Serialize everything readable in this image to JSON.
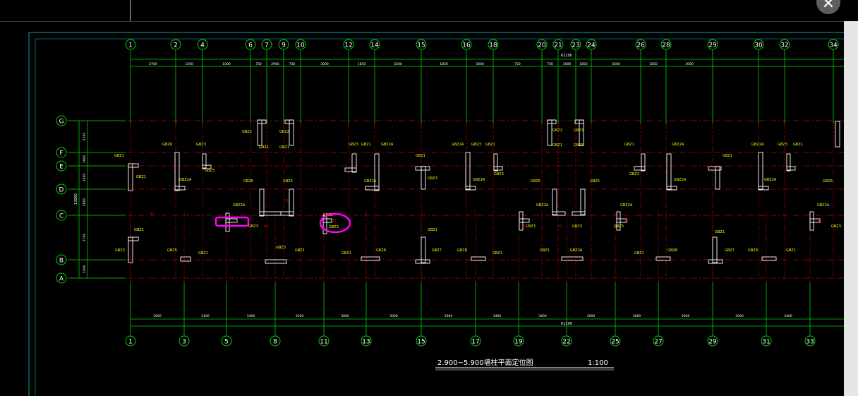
{
  "window": {
    "close_symbol": "✕",
    "close_icon": "close-icon"
  },
  "drawing": {
    "title": "2.900~5.900墙柱平面定位图",
    "scale": "1:100",
    "colors": {
      "background": "#000000",
      "grid_line": "#00d000",
      "axis_red": "#c00000",
      "wall": "#ffffff",
      "label": "#ffff00",
      "highlight": "#ff00ff",
      "border": "#00a8a8"
    },
    "top_axes": [
      "1",
      "2",
      "4",
      "6",
      "7",
      "9",
      "10",
      "12",
      "14",
      "15",
      "16",
      "18",
      "20",
      "21",
      "23",
      "24",
      "26",
      "28",
      "29",
      "30",
      "32",
      "34"
    ],
    "bottom_axes": [
      "1",
      "3",
      "5",
      "8",
      "11",
      "13",
      "15",
      "17",
      "19",
      "22",
      "25",
      "27",
      "29",
      "31",
      "33"
    ],
    "row_axes": [
      "G",
      "F",
      "E",
      "D",
      "C",
      "B",
      "A"
    ],
    "top_dims": [
      "2700",
      "1050",
      "1000",
      "750",
      "2900",
      "750",
      "3000",
      "1850",
      "3200",
      "1850",
      "3000",
      "750",
      "750",
      "3000",
      "1850",
      "3200",
      "1850",
      "3000"
    ],
    "top_total": "61200",
    "bottom_dims": [
      "3000",
      "2100",
      "3400",
      "3400",
      "3000",
      "3000",
      "3000",
      "3400",
      "3400",
      "3000",
      "3000",
      "3000",
      "3000",
      "3400"
    ],
    "bottom_total": "61200",
    "left_dims": [
      "2700",
      "1900",
      "2000",
      "2850",
      "2700",
      "1000"
    ],
    "left_total": "13000",
    "wall_labels": [
      "GBZ1",
      "GBZ2",
      "GBZ2A",
      "GBZ3",
      "GBZ4",
      "GBZ5",
      "GBZ6",
      "GBZ7",
      "GBZ8"
    ]
  }
}
